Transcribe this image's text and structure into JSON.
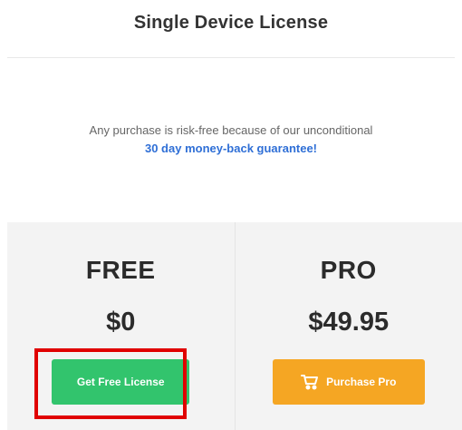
{
  "header": {
    "title": "Single Device License"
  },
  "guarantee": {
    "line1": "Any purchase is risk-free because of our unconditional",
    "link": "30 day money-back guarantee!"
  },
  "plans": [
    {
      "name": "FREE",
      "price": "$0",
      "button_label": "Get Free License",
      "button_color": "#32c46d"
    },
    {
      "name": "PRO",
      "price": "$49.95",
      "button_label": "Purchase Pro",
      "button_color": "#f5a623",
      "button_icon": "cart-icon"
    }
  ],
  "colors": {
    "link": "#2f6fd6",
    "highlight": "#e00000",
    "plans_bg": "#f3f3f3"
  }
}
